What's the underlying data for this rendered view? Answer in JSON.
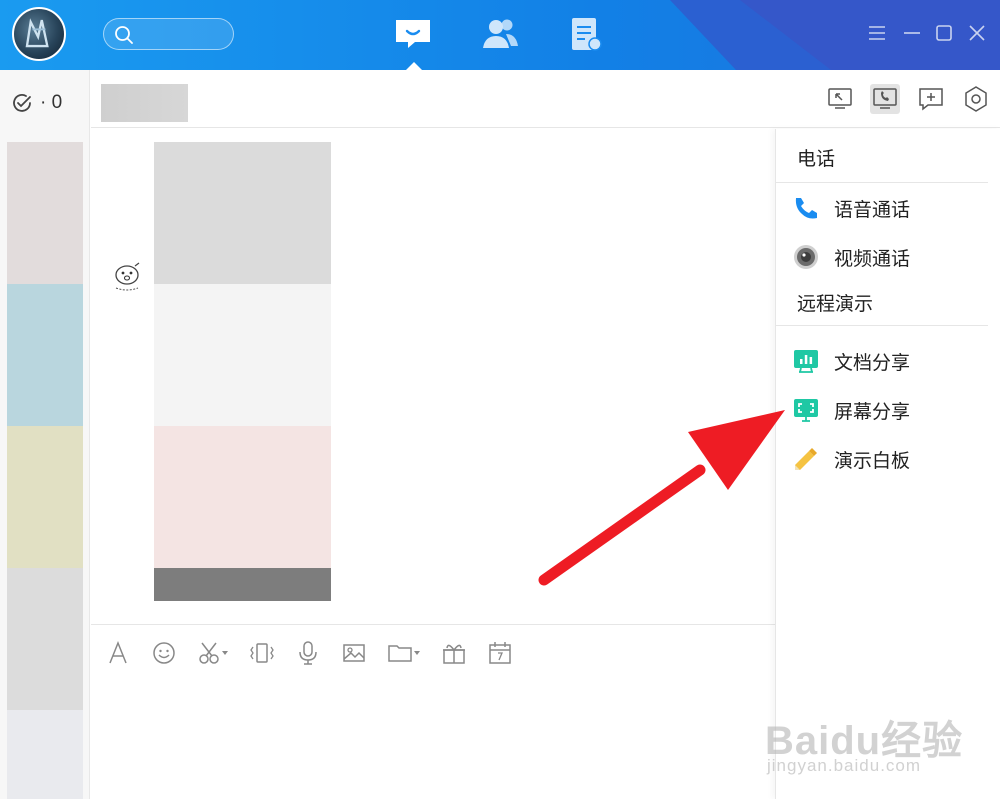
{
  "counter": {
    "icon": "check-circle-icon",
    "value": "· 0"
  },
  "titlebar": {
    "search": {
      "placeholder": ""
    },
    "nav": [
      {
        "name": "messages",
        "icon": "chat-icon",
        "active": true
      },
      {
        "name": "contacts",
        "icon": "contacts-icon",
        "active": false
      },
      {
        "name": "documents",
        "icon": "document-icon",
        "active": false
      }
    ],
    "window_controls": [
      "menu-icon",
      "minimize-icon",
      "maximize-icon",
      "close-icon"
    ]
  },
  "chat_header": {
    "tools": [
      {
        "name": "share-icon",
        "active": false
      },
      {
        "name": "phone-icon",
        "active": true
      },
      {
        "name": "add-icon",
        "active": false
      },
      {
        "name": "settings-icon",
        "active": false
      }
    ]
  },
  "input_tools": [
    "font-icon",
    "emoji-icon",
    "scissors-icon",
    "shake-icon",
    "mic-icon",
    "image-icon",
    "folder-icon",
    "gift-icon",
    "calendar-icon"
  ],
  "right_panel": {
    "phone_title": "电话",
    "phone_items": [
      {
        "label": "语音通话",
        "icon": "phone-call-icon",
        "color": "#1a8cf0"
      },
      {
        "label": "视频通话",
        "icon": "video-camera-icon",
        "color": "#555555"
      }
    ],
    "remote_title": "远程演示",
    "remote_items": [
      {
        "label": "文档分享",
        "icon": "doc-share-icon",
        "color": "#1fc8a4"
      },
      {
        "label": "屏幕分享",
        "icon": "screen-share-icon",
        "color": "#1fc8a4"
      },
      {
        "label": "演示白板",
        "icon": "whiteboard-icon",
        "color": "#f5c342"
      }
    ]
  },
  "colors": {
    "titlebar": "#1a8cf0",
    "accent_teal": "#1fc8a4",
    "arrow": "#ee1c24"
  },
  "watermark": {
    "main": "Baidu经验",
    "sub": "jingyan.baidu.com"
  }
}
